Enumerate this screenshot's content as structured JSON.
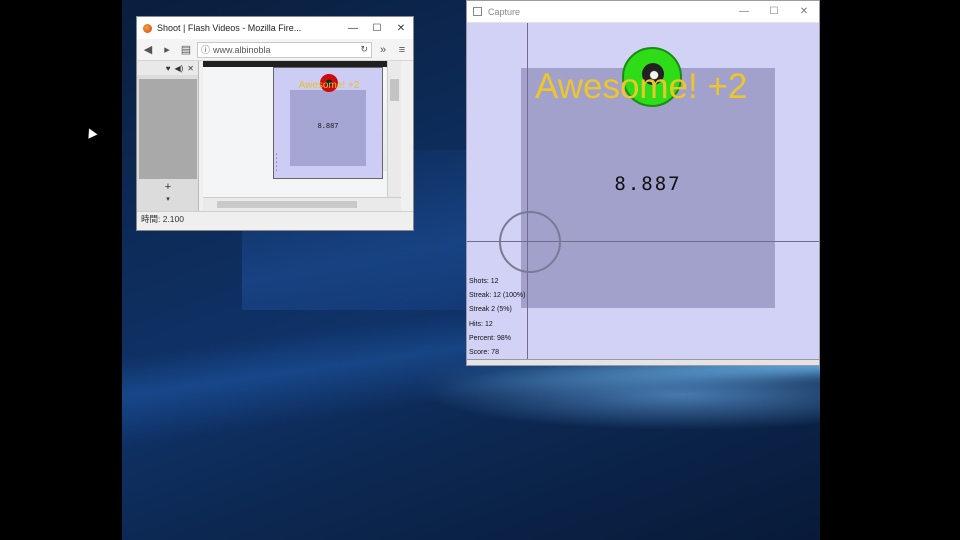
{
  "firefox": {
    "title": "Shoot | Flash Videos - Mozilla Fire...",
    "controls": {
      "minimize": "—",
      "maximize": "☐",
      "close": "✕"
    },
    "url": "www.albinobla",
    "status": "時間: 2.100",
    "sidebar": {
      "plus": "+",
      "down": "▾"
    },
    "thumbnail": {
      "countdown": "8.887"
    }
  },
  "capture": {
    "title": "Capture",
    "controls": {
      "minimize": "—",
      "maximize": "☐",
      "close": "✕"
    },
    "feedback": "Awesome! +2",
    "countdown": "8.887",
    "stats": [
      "Shots: 12",
      "Streak: 12 (100%)",
      "Streak 2 (5%)",
      "Hits: 12",
      "Percent: 98%",
      "Score: 78"
    ]
  },
  "colors": {
    "game_bg": "#d2d2f6",
    "feedback": "#ecc62a",
    "target_green": "#2fdc18"
  }
}
